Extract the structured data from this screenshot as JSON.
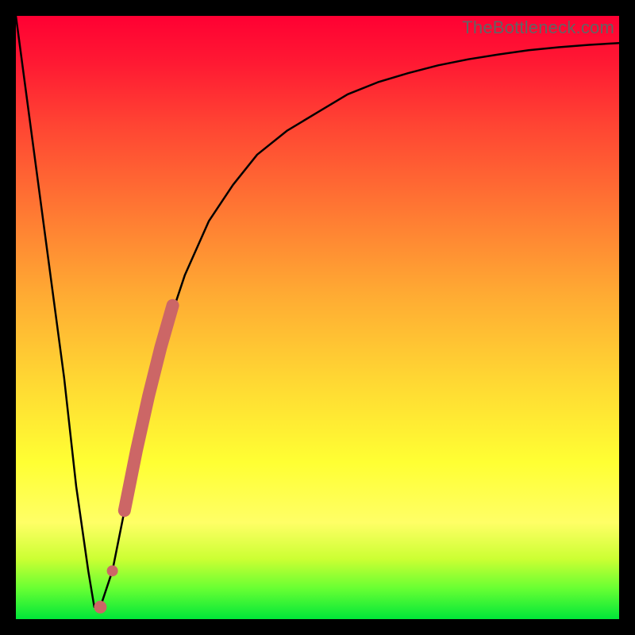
{
  "watermark": "TheBottleneck.com",
  "chart_data": {
    "type": "line",
    "title": "",
    "xlabel": "",
    "ylabel": "",
    "xlim": [
      0,
      100
    ],
    "ylim": [
      0,
      100
    ],
    "series": [
      {
        "name": "bottleneck-curve",
        "x": [
          0,
          4,
          8,
          10,
          12,
          13,
          14,
          16,
          18,
          20,
          22,
          24,
          28,
          32,
          36,
          40,
          45,
          50,
          55,
          60,
          65,
          70,
          75,
          80,
          85,
          90,
          95,
          100
        ],
        "values": [
          100,
          70,
          40,
          22,
          8,
          2,
          2,
          8,
          18,
          28,
          37,
          45,
          57,
          66,
          72,
          77,
          81,
          84,
          87,
          89,
          90.5,
          91.8,
          92.8,
          93.6,
          94.3,
          94.8,
          95.2,
          95.5
        ]
      }
    ],
    "highlight_segment": {
      "name": "highlight",
      "x": [
        14,
        16,
        18,
        20,
        22,
        24,
        26
      ],
      "values": [
        2,
        8,
        18,
        28,
        37,
        45,
        52
      ]
    },
    "background_gradient": {
      "direction": "vertical",
      "stops": [
        {
          "pos": 0.0,
          "color": "#ff0033"
        },
        {
          "pos": 0.18,
          "color": "#ff4433"
        },
        {
          "pos": 0.46,
          "color": "#ffaa33"
        },
        {
          "pos": 0.74,
          "color": "#ffff33"
        },
        {
          "pos": 0.9,
          "color": "#ccff33"
        },
        {
          "pos": 1.0,
          "color": "#00e639"
        }
      ]
    }
  }
}
